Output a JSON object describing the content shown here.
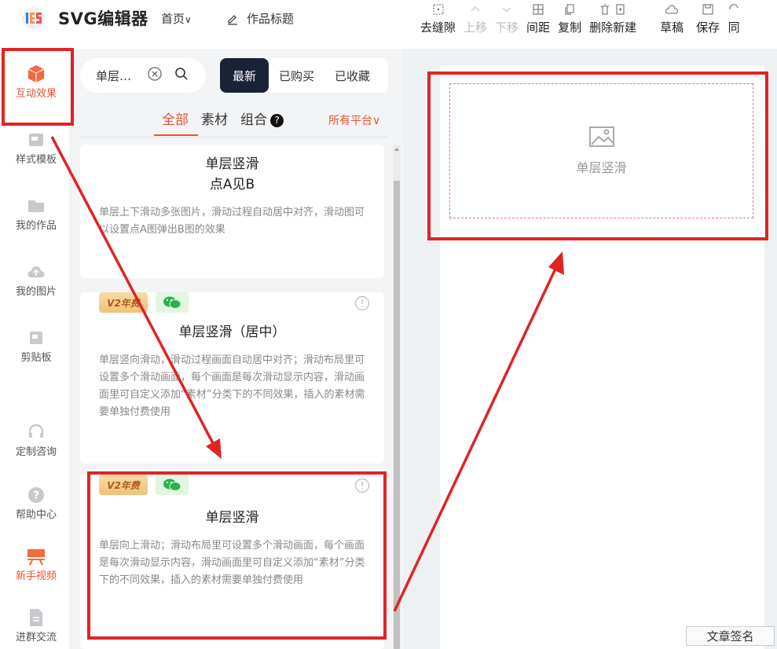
{
  "app": {
    "name": "SVG编辑器"
  },
  "nav": {
    "home": "首页",
    "work_title": "作品标题"
  },
  "toolbar": [
    {
      "label": "去缝隙",
      "icon": "grid-dots-icon",
      "enabled": true
    },
    {
      "label": "上移",
      "icon": "arrow-up-icon",
      "enabled": false
    },
    {
      "label": "下移",
      "icon": "arrow-down-icon",
      "enabled": false
    },
    {
      "label": "间距",
      "icon": "spacing-icon",
      "enabled": true
    },
    {
      "label": "复制",
      "icon": "copy-icon",
      "enabled": true
    },
    {
      "label": "删除新建",
      "icon": "delete-new-icon",
      "enabled": true
    },
    {
      "label": "草稿",
      "icon": "cloud-icon",
      "enabled": true
    },
    {
      "label": "保存",
      "icon": "save-icon",
      "enabled": true
    },
    {
      "label": "同",
      "icon": "sync-icon",
      "enabled": true
    }
  ],
  "sidebar": {
    "items": [
      {
        "label": "互动效果",
        "icon": "cube-icon",
        "active": true
      },
      {
        "label": "样式模板",
        "icon": "template-icon"
      },
      {
        "label": "我的作品",
        "icon": "folder-icon"
      },
      {
        "label": "我的图片",
        "icon": "cloud-upload-icon"
      },
      {
        "label": "剪贴板",
        "icon": "clipboard-icon"
      },
      {
        "label": "定制咨询",
        "icon": "headset-icon"
      },
      {
        "label": "帮助中心",
        "icon": "help-icon"
      },
      {
        "label": "新手视频",
        "icon": "video-icon"
      },
      {
        "label": "进群交流",
        "icon": "document-icon"
      }
    ]
  },
  "search": {
    "value": "单层…"
  },
  "seg_tabs": [
    "最新",
    "已购买",
    "已收藏"
  ],
  "categories": {
    "all": "全部",
    "material": "素材",
    "combo": "组合",
    "help": "?"
  },
  "platform_filter": "所有平台",
  "cards": [
    {
      "title_line1": "单层竖滑",
      "title_line2": "点A见B",
      "desc": "单层上下滑动多张图片，滑动过程自动居中对齐，滑动图可以设置点A图弹出B图的效果"
    },
    {
      "badge_v2": "V2年费",
      "title": "单层竖滑（居中）",
      "desc": "单层竖向滑动，滑动过程画面自动居中对齐；滑动布局里可设置多个滑动画面，每个画面是每次滑动显示内容，滑动画面里可自定义添加“素材”分类下的不同效果，插入的素材需要单独付费使用"
    },
    {
      "badge_v2": "V2年费",
      "title": "单层竖滑",
      "desc": "单层向上滑动；滑动布局里可设置多个滑动画面，每个画面是每次滑动显示内容，滑动画面里可自定义添加“素材”分类下的不同效果，插入的素材需要单独付费使用"
    }
  ],
  "canvas": {
    "placeholder_label": "单层竖滑",
    "signature_button": "文章签名"
  },
  "colors": {
    "accent": "#e8552f",
    "annotation": "#e02424",
    "tab_active_bg": "#1a2236"
  }
}
